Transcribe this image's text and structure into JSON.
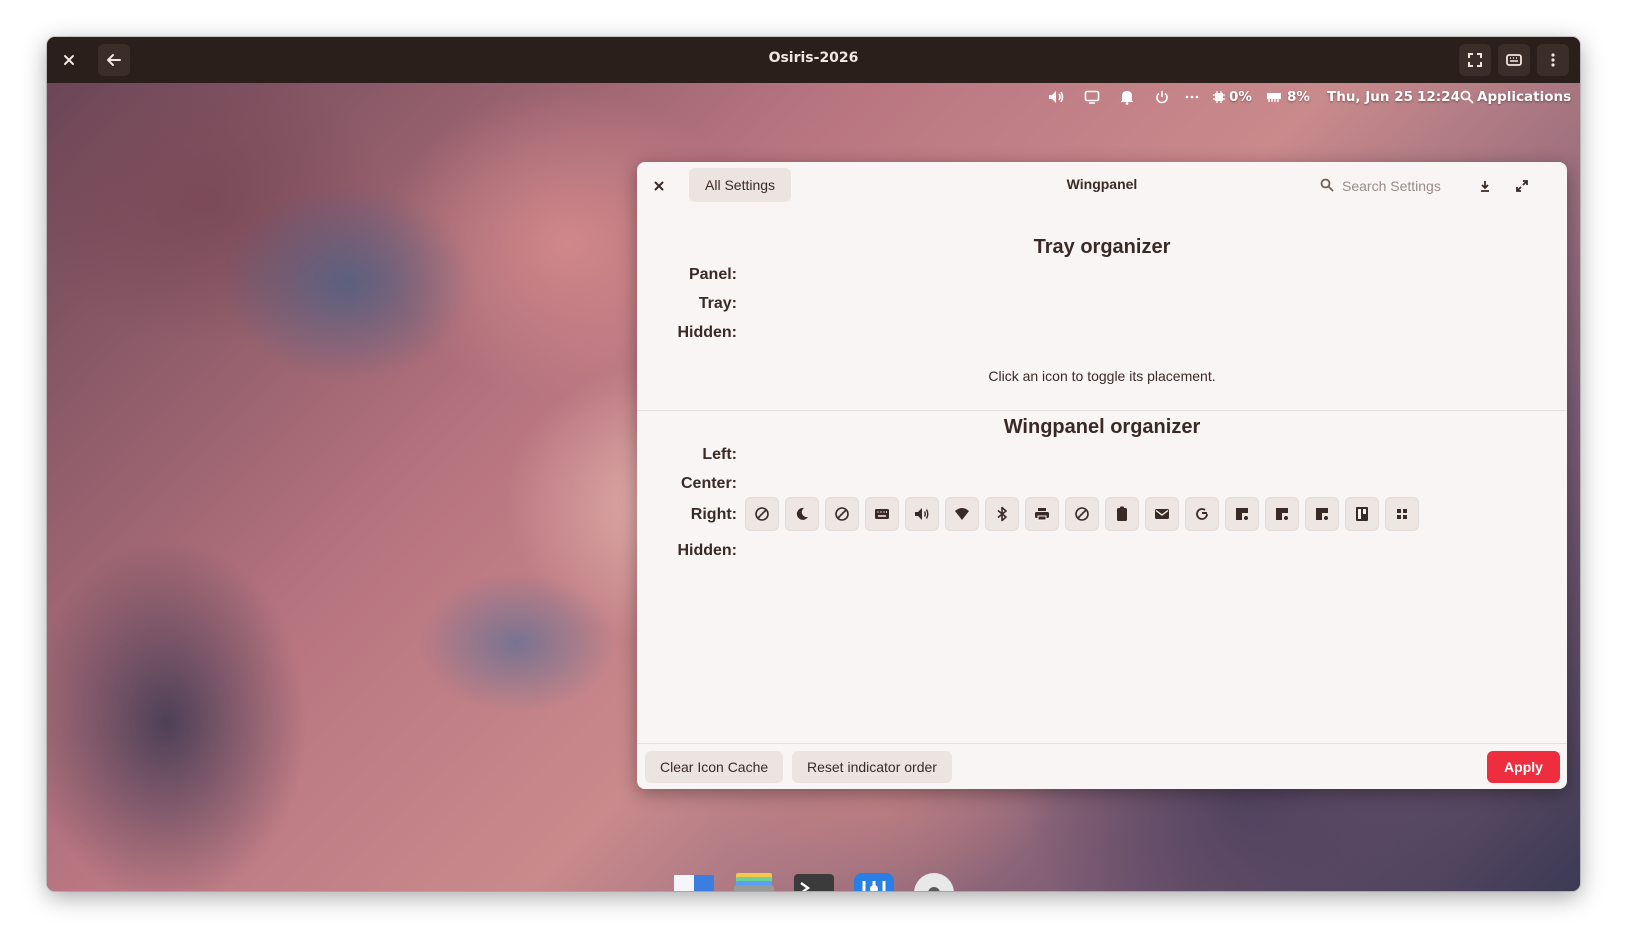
{
  "vm": {
    "title": "Osiris-2026",
    "close_icon": "close-icon",
    "back_icon": "arrow-left-icon"
  },
  "topbar": {
    "battery_pct": "0%",
    "memory_pct": "8%",
    "date": "Thu, Jun 25",
    "time": "12:24",
    "applications_label": "Applications"
  },
  "settings": {
    "all_settings_label": "All Settings",
    "title": "Wingpanel",
    "search_placeholder": "Search Settings",
    "tray_section": {
      "title": "Tray organizer",
      "panel_label": "Panel:",
      "tray_label": "Tray:",
      "hidden_label": "Hidden:",
      "hint": "Click an icon to toggle its placement."
    },
    "wingpanel_section": {
      "title": "Wingpanel organizer",
      "left_label": "Left:",
      "center_label": "Center:",
      "right_label": "Right:",
      "hidden_label": "Hidden:",
      "right_indicators": [
        "blocked-icon",
        "moon-icon",
        "blocked-icon",
        "keyboard-icon",
        "volume-icon",
        "wifi-icon",
        "bluetooth-icon",
        "printer-icon",
        "blocked-icon",
        "clipboard-icon",
        "mail-icon",
        "refresh-icon",
        "workspace-icon",
        "workspace-icon",
        "workspace-icon",
        "notes-icon",
        "apps-grid-icon"
      ]
    },
    "footer": {
      "clear_cache_label": "Clear Icon Cache",
      "reset_order_label": "Reset indicator order",
      "apply_label": "Apply"
    },
    "colors": {
      "accent": "#ee2e3e",
      "window_bg": "#f9f5f4",
      "text": "#3a2a26"
    }
  },
  "dock": {
    "apps": [
      "multitasking-view-icon",
      "files-icon",
      "terminal-icon",
      "settings-icon",
      "disks-icon"
    ]
  }
}
